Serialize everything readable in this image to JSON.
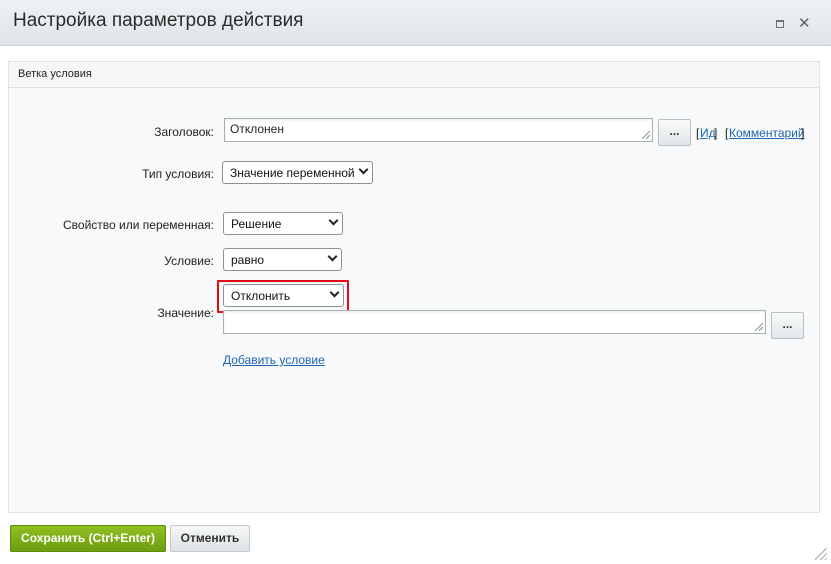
{
  "dialog": {
    "title": "Настройка параметров действия",
    "maximize_icon": "maximize-icon",
    "close_icon": "close-icon",
    "close_glyph": "✕"
  },
  "panel": {
    "header": "Ветка условия"
  },
  "form": {
    "title_label": "Заголовок:",
    "title_value": "Отклонен",
    "dots_label": "...",
    "id_link": "Ид",
    "comment_link": "Комментарий",
    "bracket_open": "[",
    "bracket_close": "]",
    "condition_type_label": "Тип условия:",
    "condition_type_value": "Значение переменной",
    "property_label": "Свойство или переменная:",
    "property_value": "Решение",
    "condition_label": "Условие:",
    "condition_value": "равно",
    "value_label": "Значение:",
    "value_select": "Отклонить",
    "value_text": "",
    "add_condition_link": "Добавить условие"
  },
  "footer": {
    "save_button": "Сохранить (Ctrl+Enter)",
    "cancel_button": "Отменить"
  },
  "colors": {
    "save_green": "#7aa819",
    "link_blue": "#2067b0",
    "highlight_red": "#e30b17"
  }
}
